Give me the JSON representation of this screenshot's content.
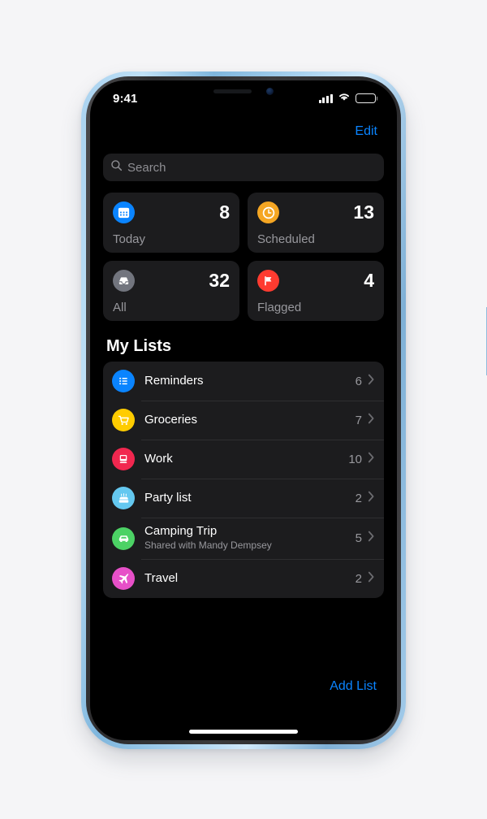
{
  "device": {
    "frame_color": "#a9d2ef",
    "screen_background": "#000000"
  },
  "status_bar": {
    "time": "9:41",
    "cellular_icon": "signal-bars-icon",
    "cellular_bars": 4,
    "wifi_icon": "wifi-icon",
    "battery_icon": "battery-icon",
    "battery_level": 100
  },
  "nav": {
    "edit_label": "Edit"
  },
  "search": {
    "icon": "search-icon",
    "placeholder": "Search",
    "value": ""
  },
  "summary_cards": [
    {
      "label": "Today",
      "count": "8",
      "icon": "calendar-icon",
      "color": "#0a84ff"
    },
    {
      "label": "Scheduled",
      "count": "13",
      "icon": "clock-icon",
      "color": "#f5a623"
    },
    {
      "label": "All",
      "count": "32",
      "icon": "inbox-icon",
      "color": "#72757e"
    },
    {
      "label": "Flagged",
      "count": "4",
      "icon": "flag-icon",
      "color": "#ff3b30"
    }
  ],
  "my_lists": {
    "heading": "My Lists",
    "items": [
      {
        "title": "Reminders",
        "subtitle": "",
        "count": "6",
        "icon": "list-bullet-icon",
        "color": "#0a84ff"
      },
      {
        "title": "Groceries",
        "subtitle": "",
        "count": "7",
        "icon": "shopping-cart-icon",
        "color": "#ffcc00"
      },
      {
        "title": "Work",
        "subtitle": "",
        "count": "10",
        "icon": "computer-monitor-icon",
        "color": "#f1274f"
      },
      {
        "title": "Party list",
        "subtitle": "",
        "count": "2",
        "icon": "birthday-cake-icon",
        "color": "#64c8f0"
      },
      {
        "title": "Camping Trip",
        "subtitle": "Shared with Mandy Dempsey",
        "count": "5",
        "icon": "car-icon",
        "color": "#4cd265"
      },
      {
        "title": "Travel",
        "subtitle": "",
        "count": "2",
        "icon": "airplane-icon",
        "color": "#e750c8"
      }
    ],
    "chevron_icon": "chevron-right-icon"
  },
  "footer": {
    "add_list_label": "Add List"
  },
  "colors": {
    "accent_blue": "#0a84ff",
    "card_background": "#1c1c1e",
    "secondary_text": "#98989d"
  }
}
